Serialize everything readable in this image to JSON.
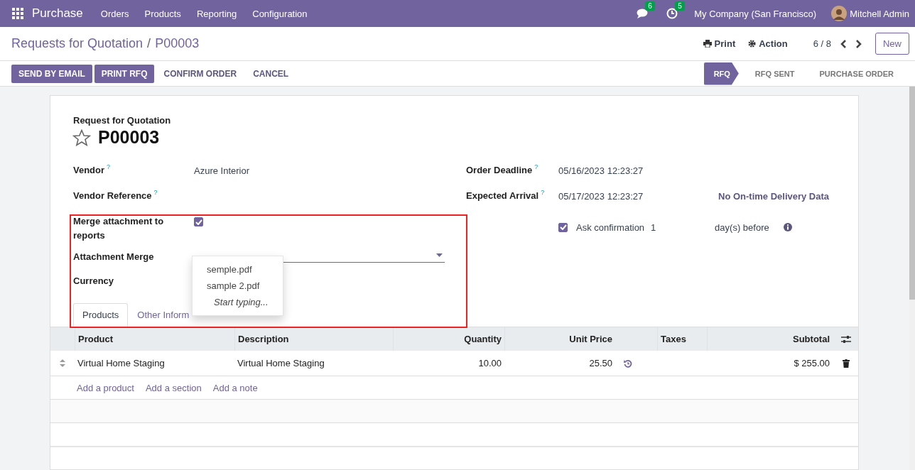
{
  "navbar": {
    "app": "Purchase",
    "menu": [
      "Orders",
      "Products",
      "Reporting",
      "Configuration"
    ],
    "messages_count": "6",
    "activities_count": "5",
    "company": "My Company (San Francisco)",
    "user": "Mitchell Admin"
  },
  "breadcrumb": {
    "parent": "Requests for Quotation",
    "separator": "/",
    "current": "P00003"
  },
  "control_panel": {
    "print": "Print",
    "action": "Action",
    "pager": "6 / 8",
    "new_button": "New"
  },
  "buttons": [
    {
      "label": "SEND BY EMAIL",
      "kind": "primary"
    },
    {
      "label": "PRINT RFQ",
      "kind": "primary"
    },
    {
      "label": "CONFIRM ORDER",
      "kind": "secondary"
    },
    {
      "label": "CANCEL",
      "kind": "secondary"
    }
  ],
  "status_steps": [
    {
      "label": "RFQ",
      "selected": true
    },
    {
      "label": "RFQ SENT",
      "selected": false
    },
    {
      "label": "PURCHASE ORDER",
      "selected": false
    }
  ],
  "form": {
    "subtitle": "Request for Quotation",
    "title": "P00003",
    "starred": false,
    "left_fields": [
      {
        "kind": "text",
        "label": "Vendor",
        "help": "?",
        "value": "Azure Interior"
      },
      {
        "kind": "text",
        "label": "Vendor Reference",
        "help": "?"
      },
      {
        "kind": "checkbox",
        "label": "Merge attachment to reports",
        "checked": true
      },
      {
        "kind": "dropdown",
        "label": "Attachment Merge",
        "options": [
          "semple.pdf",
          "sample 2.pdf"
        ],
        "hint": "Start typing..."
      },
      {
        "kind": "text",
        "label": "Currency"
      }
    ],
    "right_fields": [
      {
        "label": "Order Deadline",
        "help": "?",
        "value": "05/16/2023 12:23:27"
      },
      {
        "label": "Expected Arrival",
        "help": "?",
        "value": "05/17/2023 12:23:27",
        "extra": "No On-time Delivery Data"
      }
    ],
    "ask_confirmation": {
      "label": "Ask confirmation",
      "checked": true,
      "value": "1",
      "suffix": "day(s) before"
    },
    "highlight_frame": true,
    "tabs": [
      {
        "label": "Products",
        "selected": true
      },
      {
        "label": "Other Inform",
        "selected": false
      }
    ]
  },
  "table": {
    "columns": [
      "Product",
      "Description",
      "Quantity",
      "Unit Price",
      "Taxes",
      "Subtotal"
    ],
    "rows": [
      {
        "product": "Virtual Home Staging",
        "description": "Virtual Home Staging",
        "quantity": "10.00",
        "unit_price": "25.50",
        "subtotal": "$ 255.00"
      }
    ],
    "add_links": [
      "Add a product",
      "Add a section",
      "Add a note"
    ]
  }
}
